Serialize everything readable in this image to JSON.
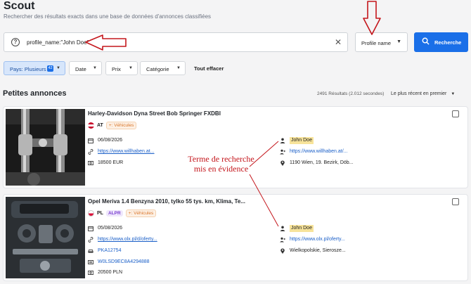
{
  "header": {
    "title": "Scout",
    "subtitle": "Rechercher des résultats exacts dans une base de données d'annonces classifiées"
  },
  "search": {
    "value": "profile_name:\"John Doe\"",
    "field": "Profile name",
    "button": "Recherche"
  },
  "filters": {
    "country": "Pays: Plusieurs",
    "country_count": "42",
    "date": "Date",
    "price": "Prix",
    "category": "Catégorie",
    "clear_all": "Tout effacer"
  },
  "results": {
    "section_title": "Petites annonces",
    "count": "2491 Résultats (2.012 secondes)",
    "sort": "Le plus récent en premier"
  },
  "listings": [
    {
      "title": "Harley-Davidson Dyna Street Bob Springer FXDBI",
      "country": "AT",
      "category": "+: Véhicules",
      "date": "06/08/2026",
      "url": "https://www.willhaben.at...",
      "price": "18500 EUR",
      "user": "John Doe",
      "profile_url": "https://www.willhaben.at/...",
      "location": "1190 Wien, 19. Bezirk, Döb..."
    },
    {
      "title": "Opel Meriva 1.4 Benzyna 2010, tylko 55 tys. km, Klima, Te...",
      "country": "PL",
      "source_tag": "ALPR",
      "category": "+: Véhicules",
      "date": "05/08/2026",
      "url": "https://www.olx.pl/d/oferty...",
      "plate": "PKA12754",
      "vin": "W0LSD9EC8A4294888",
      "price": "20500 PLN",
      "user": "John Doe",
      "profile_url": "https://www.olx.pl/oferty...",
      "location": "Wielkopolskie, Sierosze..."
    }
  ],
  "annotation": {
    "line1": "Terme de recherche",
    "line2": "mis en évidence"
  },
  "colors": {
    "accent": "#1a6fe8",
    "annotation": "#c4161c",
    "highlight": "#f7e39a"
  }
}
